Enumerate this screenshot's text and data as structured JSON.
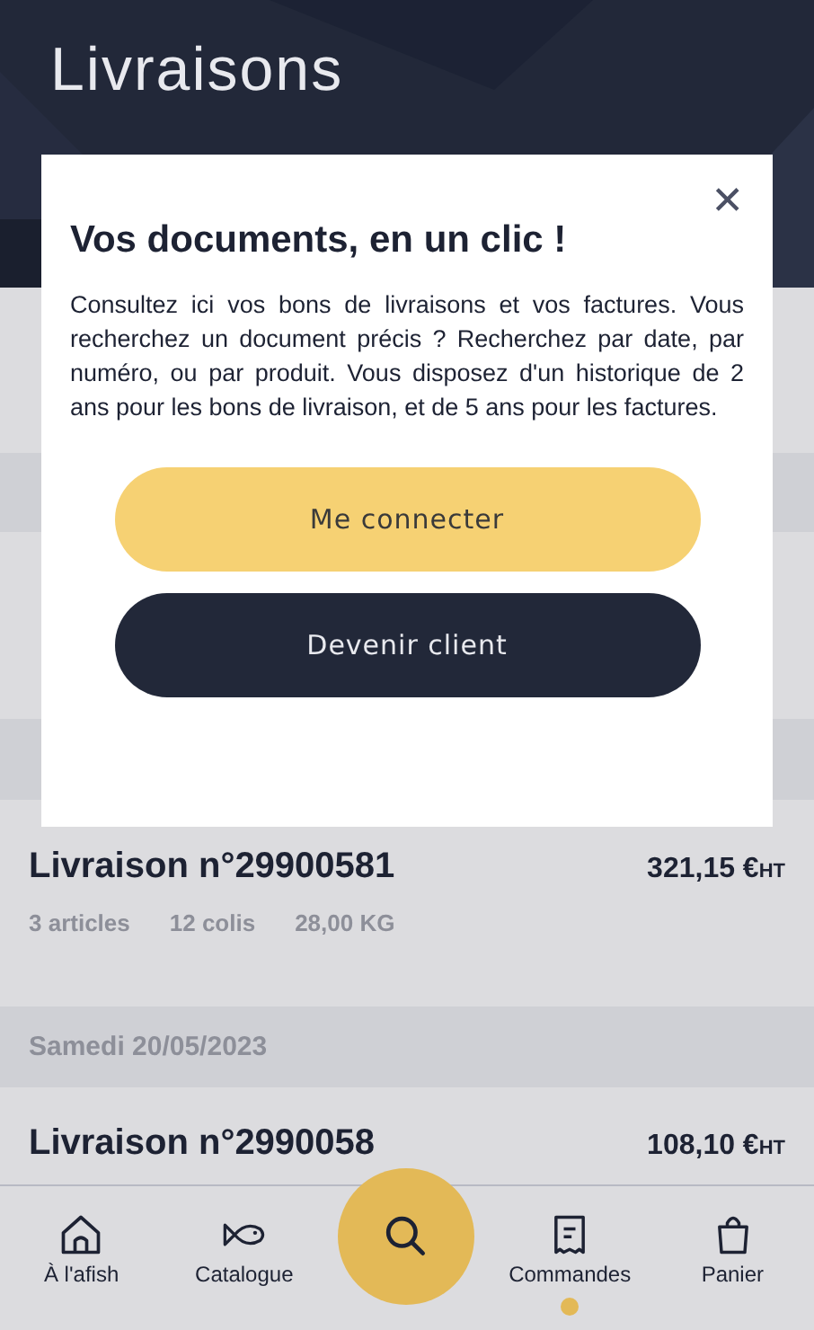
{
  "header": {
    "title": "Livraisons"
  },
  "sections": [
    {
      "rows": [
        {
          "title": "Livraison n°29900581",
          "meta": [
            "3 articles",
            "12 colis",
            "28,00 KG"
          ],
          "price": "321,15 €",
          "unit": "HT"
        }
      ]
    },
    {
      "date": "Samedi 20/05/2023",
      "rows": [
        {
          "title": "Livraison n°2990058",
          "price": "108,10 €",
          "unit": "HT"
        }
      ]
    }
  ],
  "modal": {
    "close": "✕",
    "title": "Vos documents, en un clic !",
    "body": "Consultez ici vos bons de livraisons et vos factures. Vous recherchez un document précis ? Recherchez par date, par numéro, ou par produit. Vous disposez d'un historique de 2 ans pour les bons de livraison, et de 5 ans pour les factures.",
    "buttons": [
      {
        "label": "Me connecter",
        "kind": "primary"
      },
      {
        "label": "Devenir client",
        "kind": "secondary"
      }
    ]
  },
  "nav": [
    {
      "label": "À l'afish",
      "kind": "home",
      "selected": false
    },
    {
      "label": "Catalogue",
      "kind": "fish",
      "selected": false
    },
    {
      "kind": "search",
      "selected": false
    },
    {
      "label": "Commandes",
      "kind": "receipt",
      "selected": true
    },
    {
      "label": "Panier",
      "kind": "bag",
      "selected": false
    }
  ]
}
